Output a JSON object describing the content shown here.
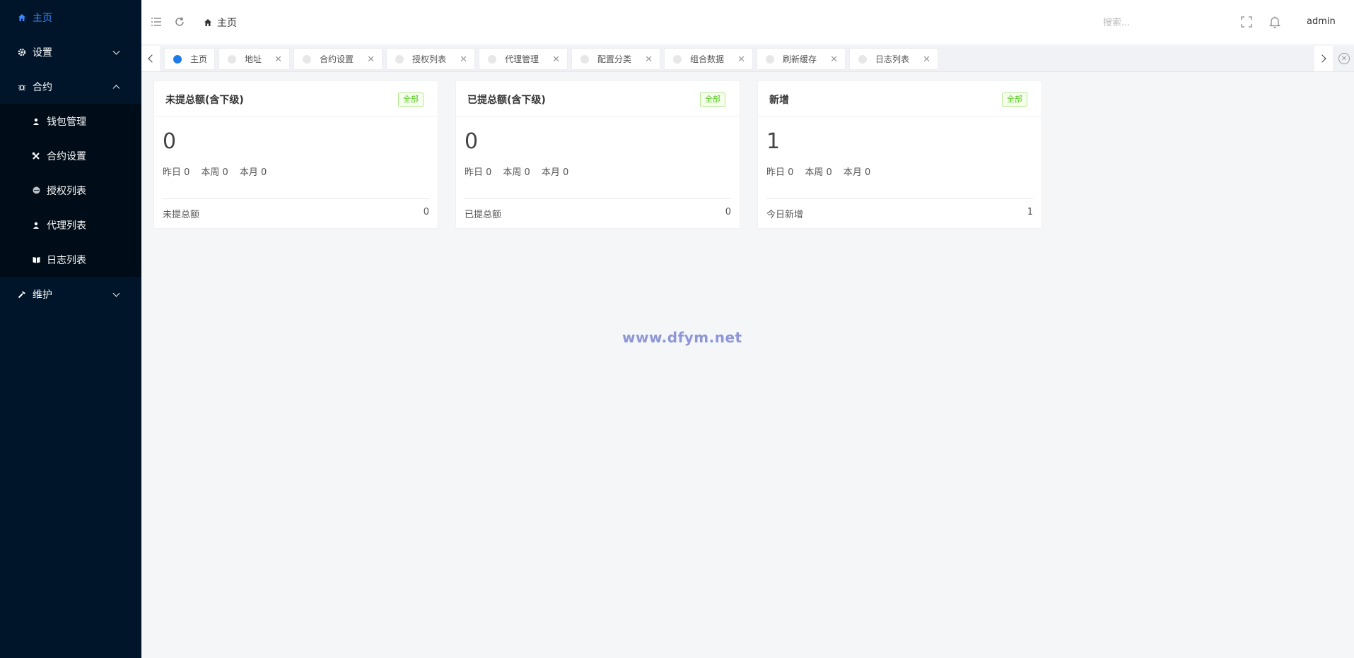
{
  "sidebar": {
    "items": [
      {
        "label": "主页",
        "icon": "home-icon",
        "active": true
      },
      {
        "label": "设置",
        "icon": "gear-icon",
        "expanded": false
      },
      {
        "label": "合约",
        "icon": "bug-icon",
        "expanded": true,
        "children": [
          {
            "label": "钱包管理",
            "icon": "user-icon"
          },
          {
            "label": "合约设置",
            "icon": "tools-icon"
          },
          {
            "label": "授权列表",
            "icon": "circle-icon"
          },
          {
            "label": "代理列表",
            "icon": "user-icon"
          },
          {
            "label": "日志列表",
            "icon": "book-icon"
          }
        ]
      },
      {
        "label": "维护",
        "icon": "hammer-icon",
        "expanded": false
      }
    ]
  },
  "header": {
    "breadcrumb": "主页",
    "search_placeholder": "搜索...",
    "user": "admin"
  },
  "tabs": [
    {
      "label": "主页",
      "active": true,
      "closable": false
    },
    {
      "label": "地址",
      "closable": true
    },
    {
      "label": "合约设置",
      "closable": true
    },
    {
      "label": "授权列表",
      "closable": true
    },
    {
      "label": "代理管理",
      "closable": true
    },
    {
      "label": "配置分类",
      "closable": true
    },
    {
      "label": "组合数据",
      "closable": true
    },
    {
      "label": "刷新缓存",
      "closable": true
    },
    {
      "label": "日志列表",
      "closable": true
    }
  ],
  "cards": [
    {
      "title": "未提总额(含下级)",
      "badge": "全部",
      "value": "0",
      "stats": {
        "yesterday": "昨日 0",
        "week": "本周 0",
        "month": "本月 0"
      },
      "footer_label": "未提总额",
      "footer_value": "0"
    },
    {
      "title": "已提总额(含下级)",
      "badge": "全部",
      "value": "0",
      "stats": {
        "yesterday": "昨日 0",
        "week": "本周 0",
        "month": "本月 0"
      },
      "footer_label": "已提总额",
      "footer_value": "0"
    },
    {
      "title": "新增",
      "badge": "全部",
      "value": "1",
      "stats": {
        "yesterday": "昨日 0",
        "week": "本周 0",
        "month": "本月 0"
      },
      "footer_label": "今日新增",
      "footer_value": "1"
    }
  ],
  "watermark": "www.dfym.net",
  "colors": {
    "sidebar_bg": "#001529",
    "submenu_bg": "#000c17",
    "accent": "#3d86ff",
    "badge_green": "#52c41a"
  }
}
